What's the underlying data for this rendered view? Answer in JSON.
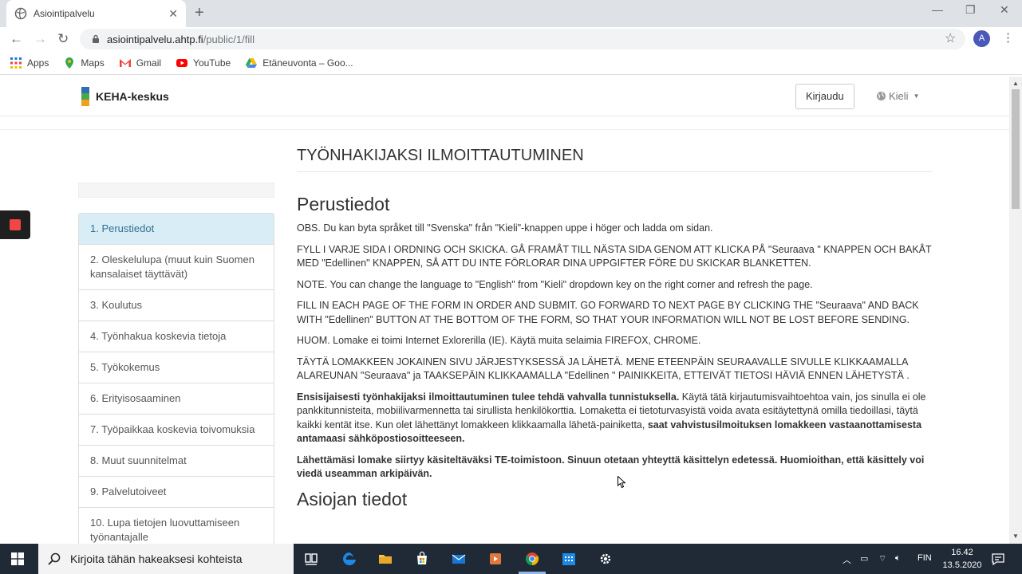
{
  "browser": {
    "tab_title": "Asiointipalvelu",
    "url_host": "asiointipalvelu.ahtp.fi",
    "url_path": "/public/1/fill",
    "avatar_letter": "A",
    "bookmarks": [
      "Apps",
      "Maps",
      "Gmail",
      "YouTube",
      "Etäneuvonta – Goo..."
    ]
  },
  "site": {
    "brand": "KEHA-keskus",
    "login_label": "Kirjaudu",
    "language_label": "Kieli"
  },
  "sidebar": {
    "steps": [
      "1. Perustiedot",
      "2. Oleskelulupa (muut kuin Suomen kansalaiset täyttävät)",
      "3. Koulutus",
      "4. Työnhakua koskevia tietoja",
      "5. Työkokemus",
      "6. Erityisosaaminen",
      "7. Työpaikkaa koskevia toivomuksia",
      "8. Muut suunnitelmat",
      "9. Palvelutoiveet",
      "10. Lupa tietojen luovuttamiseen työnantajalle"
    ]
  },
  "main": {
    "page_title": "TYÖNHAKIJAKSI ILMOITTAUTUMINEN",
    "section_title": "Perustiedot",
    "p1": "OBS. Du kan byta språket till \"Svenska\" från \"Kieli\"-knappen uppe i höger och ladda om sidan.",
    "p2": "FYLL I VARJE SIDA I ORDNING OCH SKICKA. GÅ FRAMÅT TILL NÄSTA SIDA GENOM ATT KLICKA PÅ \"Seuraava \" KNAPPEN OCH BAKÅT MED \"Edellinen\" KNAPPEN, SÅ ATT DU INTE FÖRLORAR DINA UPPGIFTER FÖRE DU SKICKAR BLANKETTEN.",
    "p3": "NOTE. You can change the language to \"English\" from \"Kieli\" dropdown key on the right corner and refresh the page.",
    "p4": "FILL IN EACH PAGE OF THE FORM IN ORDER AND SUBMIT. GO FORWARD TO NEXT PAGE BY CLICKING THE \"Seuraava\" AND BACK WITH \"Edellinen\" BUTTON AT THE BOTTOM OF THE FORM, SO THAT YOUR INFORMATION WILL NOT BE LOST BEFORE SENDING.",
    "p5": "HUOM. Lomake ei toimi Internet Exlorerilla (IE). Käytä muita selaimia FIREFOX, CHROME.",
    "p6": "TÄYTÄ LOMAKKEEN JOKAINEN SIVU JÄRJESTYKSESSÄ JA LÄHETÄ. MENE ETEENPÄIN SEURAAVALLE SIVULLE KLIKKAAMALLA ALAREUNAN \"Seuraava\" ja TAAKSEPÄIN KLIKKAAMALLA \"Edellinen \" PAINIKKEITA, ETTEIVÄT TIETOSI HÄVIÄ ENNEN LÄHETYSTÄ .",
    "p7_bold1": "Ensisijaisesti työnhakijaksi ilmoittautuminen tulee tehdä vahvalla tunnistuksella.",
    "p7_text": " Käytä tätä kirjautumisvaihtoehtoa vain, jos sinulla ei ole pankkitunnisteita, mobiilivarmennetta tai sirullista henkilökorttia. Lomaketta ei tietoturvasyistä voida avata esitäytettynä omilla tiedoillasi, täytä kaikki kentät itse. Kun olet lähettänyt lomakkeen klikkaamalla lähetä-painiketta, ",
    "p7_bold2": "saat vahvistusilmoituksen lomakkeen vastaanottamisesta antamaasi sähköpostiosoitteeseen.",
    "p8": "Lähettämäsi lomake siirtyy käsiteltäväksi TE-toimistoon. Sinuun otetaan yhteyttä käsittelyn edetessä. Huomioithan, että käsittely voi viedä useamman arkipäivän.",
    "next_section_title": "Asiojan tiedot"
  },
  "taskbar": {
    "search_placeholder": "Kirjoita tähän hakeaksesi kohteista",
    "lang": "FIN",
    "time": "16.42",
    "date": "13.5.2020"
  },
  "colors": {
    "active_step_bg": "#d9edf7",
    "active_step_text": "#31708f",
    "taskbar": "#1f2a36"
  }
}
